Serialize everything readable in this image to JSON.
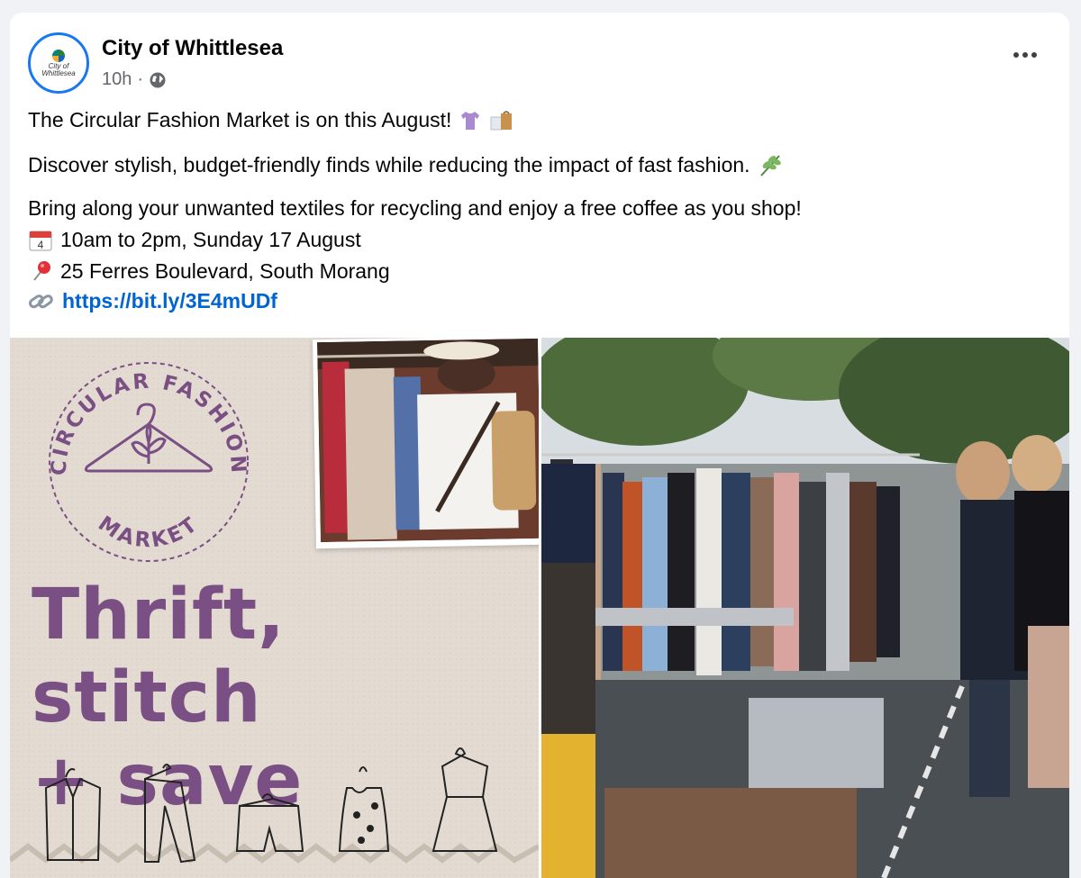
{
  "post": {
    "page_name": "City of Whittlesea",
    "avatar_text": "City of Whittlesea",
    "time": "10h",
    "separator": "·",
    "privacy_icon": "globe-icon",
    "more_icon": "more-options-icon",
    "lines": [
      {
        "text": "The Circular Fashion Market is on this August!",
        "emojis": [
          "shirt-emoji",
          "shopping-bags-emoji"
        ]
      },
      {
        "text": "Discover stylish, budget-friendly finds while reducing the impact of fast fashion.",
        "emojis": [
          "herb-emoji"
        ]
      },
      {
        "text": "Bring along your unwanted textiles for recycling and enjoy a free coffee as you shop!"
      },
      {
        "text": "10am to 2pm, Sunday 17 August",
        "icon": "calendar-emoji",
        "icon_text": "4"
      },
      {
        "text": "25 Ferres Boulevard, South Morang",
        "icon": "pushpin-emoji"
      },
      {
        "text": "https://bit.ly/3E4mUDf",
        "icon": "link-emoji"
      }
    ]
  },
  "media": {
    "badge_top": "CIRCULAR FASHION",
    "badge_bottom": "MARKET",
    "headline_line1": "Thrift, stitch",
    "headline_line2": "+ save",
    "photo_left": "woman-browsing-clothes-rack-photo",
    "photo_right": "outdoor-market-clothing-racks-photo",
    "colors": {
      "brand_purple": "#7a4f83",
      "beige": "#e3dbd2",
      "link": "#0064d1"
    }
  }
}
